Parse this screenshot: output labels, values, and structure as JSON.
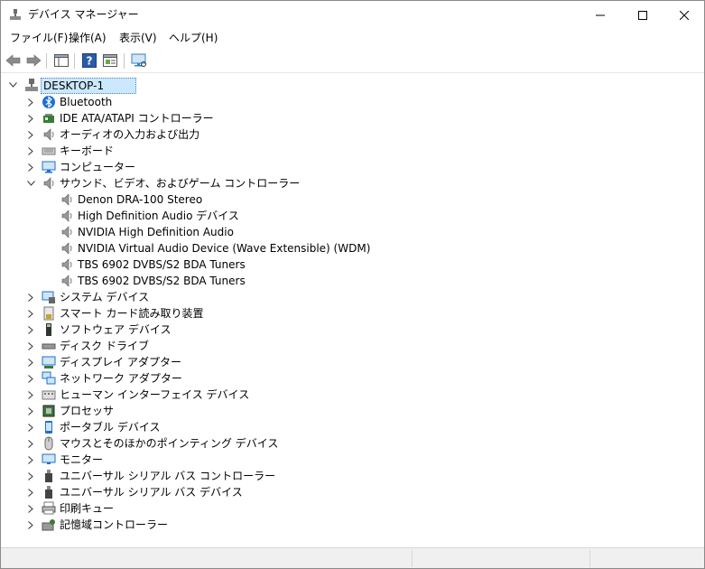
{
  "window": {
    "title": "デバイス マネージャー"
  },
  "menu": [
    {
      "label": "ファイル(F)"
    },
    {
      "label": "操作(A)"
    },
    {
      "label": "表示(V)"
    },
    {
      "label": "ヘルプ(H)"
    }
  ],
  "toolbar": {
    "back": "back-arrow-icon",
    "forward": "forward-arrow-icon",
    "properties": "properties-icon",
    "help": "help-icon",
    "show_hide": "show-hide-console-tree-icon",
    "scan": "scan-hardware-icon"
  },
  "tree": {
    "root": {
      "label": "DESKTOP-1"
    },
    "categories": [
      {
        "label": "Bluetooth",
        "icon": "bluetooth-icon"
      },
      {
        "label": "IDE ATA/ATAPI コントローラー",
        "icon": "ide-controller-icon"
      },
      {
        "label": "オーディオの入力および出力",
        "icon": "speaker-icon"
      },
      {
        "label": "キーボード",
        "icon": "keyboard-icon"
      },
      {
        "label": "コンピューター",
        "icon": "computer-icon"
      },
      {
        "label": "サウンド、ビデオ、およびゲーム コントローラー",
        "icon": "speaker-icon",
        "expanded": true,
        "children": [
          {
            "label": "Denon DRA-100 Stereo"
          },
          {
            "label": "High Definition Audio デバイス"
          },
          {
            "label": "NVIDIA High Definition Audio"
          },
          {
            "label": "NVIDIA Virtual Audio Device (Wave Extensible) (WDM)"
          },
          {
            "label": "TBS 6902 DVBS/S2 BDA Tuners"
          },
          {
            "label": "TBS 6902 DVBS/S2 BDA Tuners"
          }
        ]
      },
      {
        "label": "システム デバイス",
        "icon": "system-device-icon"
      },
      {
        "label": "スマート カード読み取り装置",
        "icon": "smart-card-reader-icon"
      },
      {
        "label": "ソフトウェア デバイス",
        "icon": "software-device-icon"
      },
      {
        "label": "ディスク ドライブ",
        "icon": "disk-drive-icon"
      },
      {
        "label": "ディスプレイ アダプター",
        "icon": "display-adapter-icon"
      },
      {
        "label": "ネットワーク アダプター",
        "icon": "network-adapter-icon"
      },
      {
        "label": "ヒューマン インターフェイス デバイス",
        "icon": "hid-icon"
      },
      {
        "label": "プロセッサ",
        "icon": "processor-icon"
      },
      {
        "label": "ポータブル デバイス",
        "icon": "portable-device-icon"
      },
      {
        "label": "マウスとそのほかのポインティング デバイス",
        "icon": "mouse-icon"
      },
      {
        "label": "モニター",
        "icon": "monitor-icon"
      },
      {
        "label": "ユニバーサル シリアル バス コントローラー",
        "icon": "usb-icon"
      },
      {
        "label": "ユニバーサル シリアル バス デバイス",
        "icon": "usb-icon"
      },
      {
        "label": "印刷キュー",
        "icon": "printer-icon"
      },
      {
        "label": "記憶域コントローラー",
        "icon": "storage-controller-icon"
      }
    ]
  },
  "colors": {
    "selection": "#cce8ff",
    "selection_border": "#4b84c4",
    "accent": "#1e6fd0"
  }
}
